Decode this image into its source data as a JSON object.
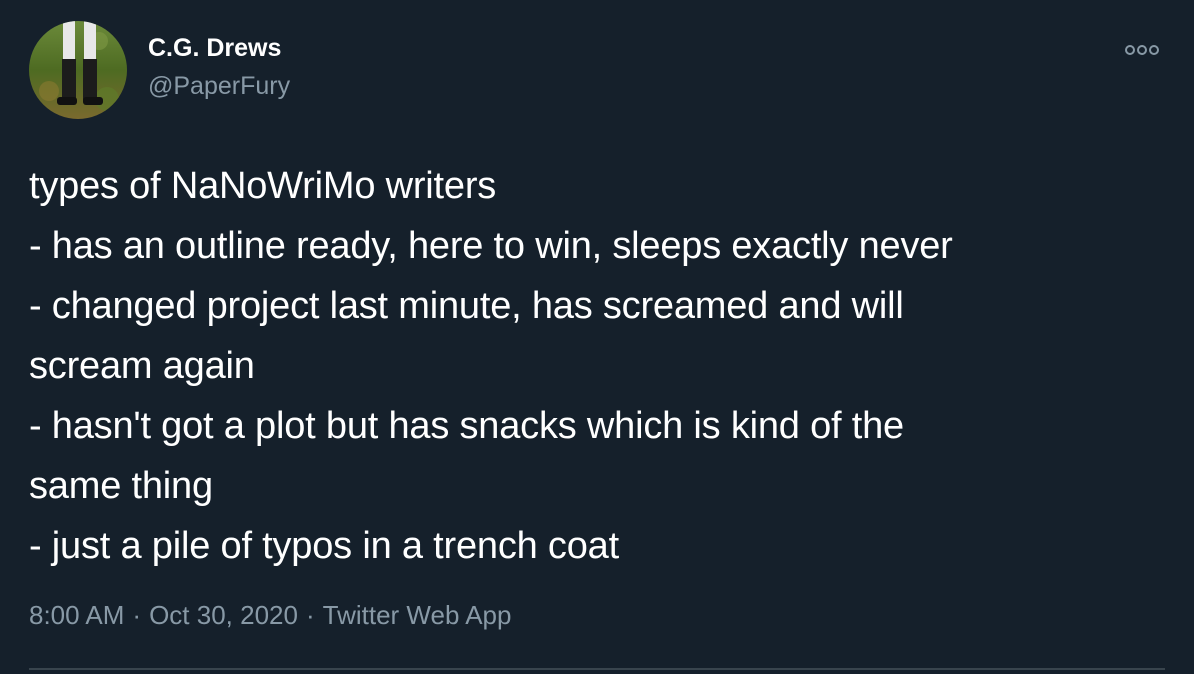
{
  "author": {
    "display_name": "C.G. Drews",
    "handle": "@PaperFury"
  },
  "tweet": {
    "lines": [
      "types of NaNoWriMo writers",
      "- has an outline ready, here to win, sleeps exactly never",
      "- changed project last minute, has screamed and will",
      "scream again",
      "- hasn't got a plot but has snacks which is kind of the",
      "same thing",
      "- just a pile of typos in a trench coat"
    ]
  },
  "meta": {
    "time": "8:00 AM",
    "separator": "·",
    "date": "Oct 30, 2020",
    "source": "Twitter Web App"
  },
  "icons": {
    "more": "more-options-icon",
    "avatar": "profile-photo"
  },
  "colors": {
    "background": "#15202b",
    "primary_text": "#ffffff",
    "secondary_text": "#8899a6",
    "divider": "#38444d"
  }
}
